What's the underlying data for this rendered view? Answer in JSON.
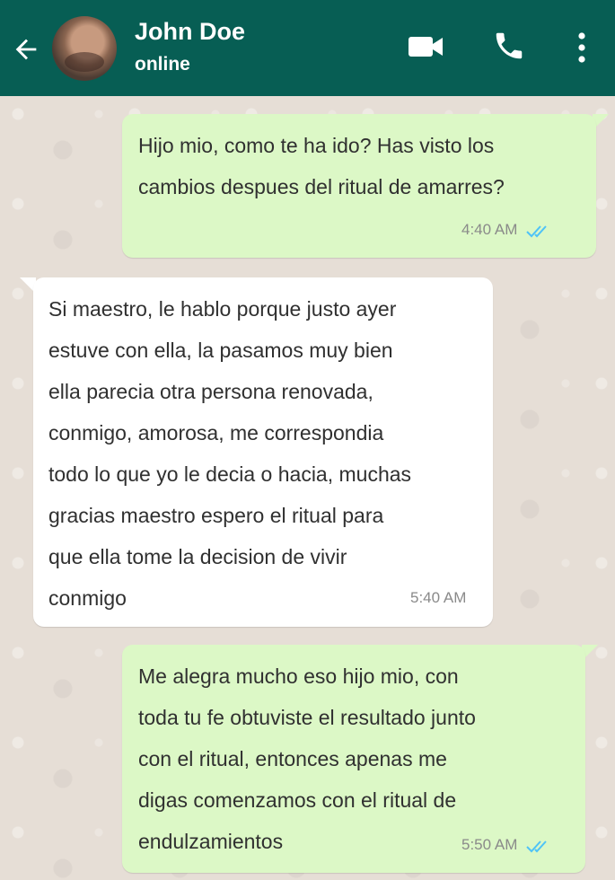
{
  "header": {
    "contact_name": "John Doe",
    "status": "online",
    "icons": [
      "back-arrow-icon",
      "avatar",
      "video-call-icon",
      "voice-call-icon",
      "more-options-icon"
    ],
    "background_color": "#075e54"
  },
  "messages": [
    {
      "direction": "outgoing",
      "text": "Hijo mio, como te ha ido? Has visto los\ncambios despues del ritual de amarres?",
      "time": "4:40 AM",
      "read_status": "read"
    },
    {
      "direction": "incoming",
      "text": "Si maestro, le hablo porque justo ayer\nestuve con ella, la pasamos muy bien\nella parecia otra persona renovada,\nconmigo, amorosa, me correspondia\ntodo lo que yo le decia o hacia, muchas\ngracias maestro espero el ritual para\nque ella tome la decision de vivir\nconmigo",
      "time": "5:40 AM"
    },
    {
      "direction": "outgoing",
      "text": "Me alegra mucho eso hijo mio, con\ntoda tu fe obtuviste el resultado junto\ncon el ritual, entonces apenas me\ndigas comenzamos con el ritual de\nendulzamientos",
      "time": "5:50 AM",
      "read_status": "read"
    }
  ],
  "colors": {
    "outgoing_bubble": "#dcf8c6",
    "incoming_bubble": "#ffffff",
    "read_ticks": "#4fc3f7"
  }
}
